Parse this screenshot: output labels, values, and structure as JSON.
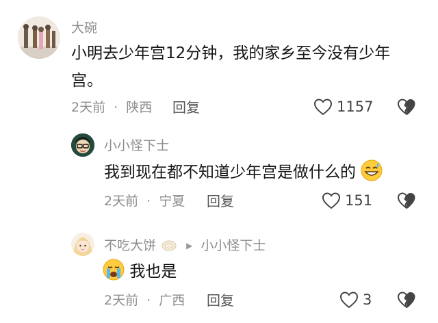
{
  "comments": [
    {
      "author": "大碗",
      "text": "小明去少年宫12分钟，我的家乡至今没有少年宫。",
      "time": "2天前",
      "sep": "·",
      "location": "陕西",
      "reply_label": "回复",
      "like_count": "1157"
    },
    {
      "author": "小小怪下士",
      "text": "我到现在都不知道少年宫是做什么的",
      "time": "2天前",
      "sep": "·",
      "location": "宁夏",
      "reply_label": "回复",
      "like_count": "151"
    },
    {
      "author": "不吃大饼",
      "reply_to": "小小怪下士",
      "text": "我也是",
      "time": "2天前",
      "sep": "·",
      "location": "广西",
      "reply_label": "回复",
      "like_count": "3"
    }
  ],
  "icons": {
    "like": "heart-outline-icon",
    "dislike": "broken-heart-icon",
    "reply_arrow": "triangle-right-icon"
  },
  "colors": {
    "meta_text": "#8c8c8c",
    "body_text": "#161616",
    "icon": "#444444"
  }
}
